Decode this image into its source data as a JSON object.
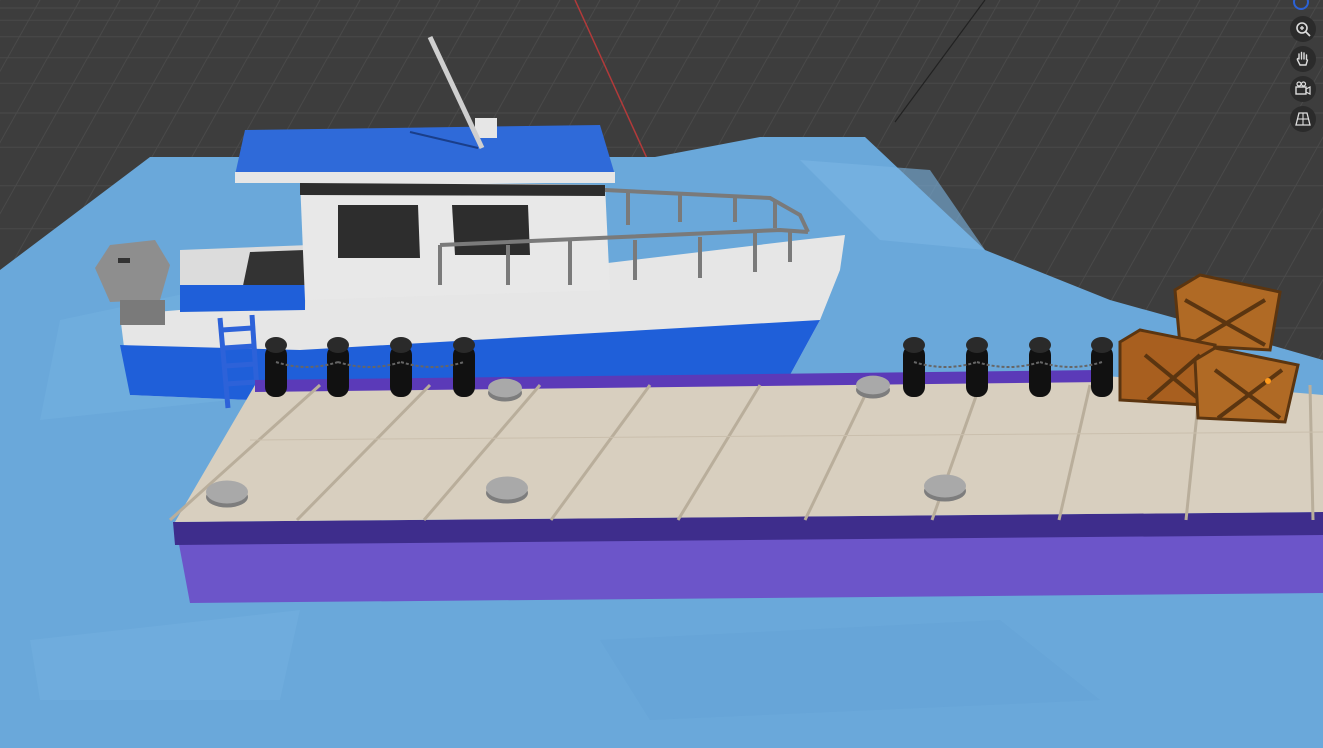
{
  "viewport": {
    "mode": "Solid",
    "background_color": "#3d3d3d",
    "grid_line_color": "#4a4a4a",
    "x_axis_color": "#b23a3a"
  },
  "scene_objects": [
    {
      "name": "water-plane",
      "color": "#6aa8da"
    },
    {
      "name": "boat-hull",
      "color": "#e6e6e6",
      "stripe_color": "#1f5fd9"
    },
    {
      "name": "boat-cabin-roof",
      "color": "#2f6ad9"
    },
    {
      "name": "outboard-motor",
      "color": "#8e8e8e"
    },
    {
      "name": "boat-railing",
      "color": "#7a7a7a"
    },
    {
      "name": "dock-deck",
      "color": "#d8cfbf"
    },
    {
      "name": "dock-side",
      "color": "#6c55c9"
    },
    {
      "name": "mooring-posts",
      "color": "#111111",
      "count": 8
    },
    {
      "name": "cleats",
      "color": "#a9a9a9",
      "count": 5
    },
    {
      "name": "wooden-crates",
      "color": "#b06a25",
      "count": 4
    }
  ],
  "navigation": {
    "zoom_icon": "zoom-icon",
    "pan_icon": "hand-icon",
    "camera_icon": "camera-icon",
    "perspective_icon": "grid-perspective-icon"
  }
}
